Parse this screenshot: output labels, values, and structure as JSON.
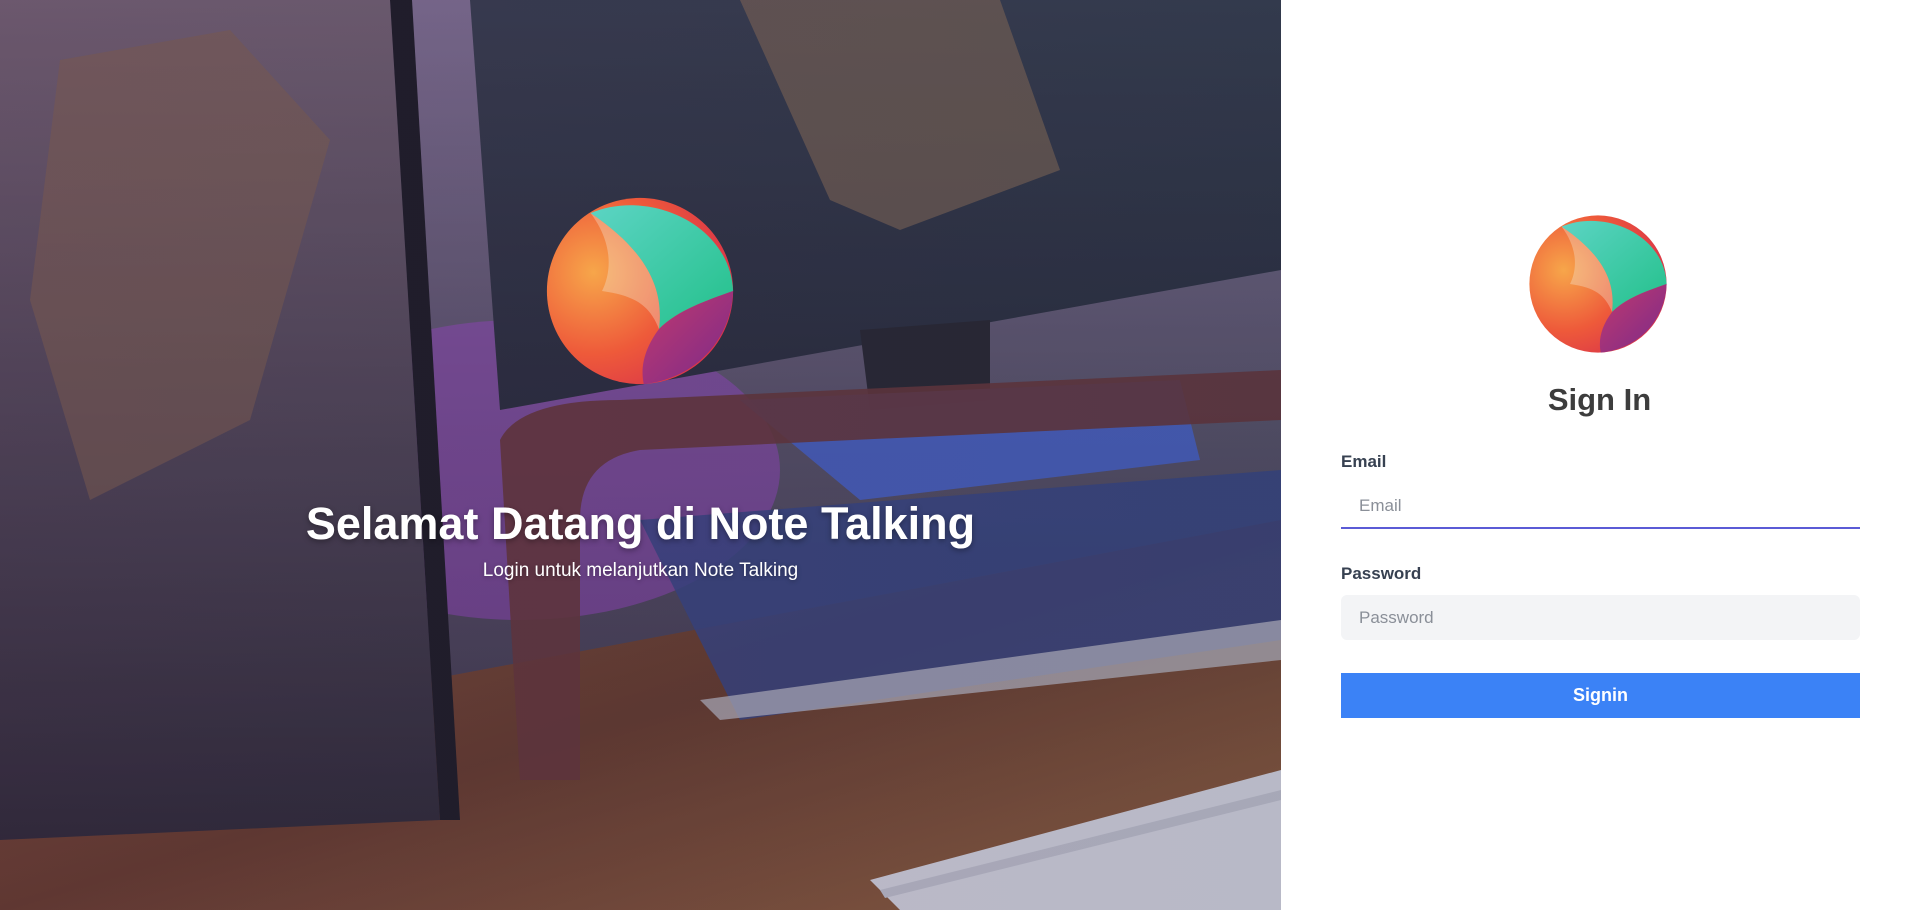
{
  "hero": {
    "title": "Selamat Datang di Note Talking",
    "subtitle": "Login untuk melanjutkan Note Talking"
  },
  "form": {
    "title": "Sign In",
    "email_label": "Email",
    "email_placeholder": "Email",
    "email_value": "",
    "password_label": "Password",
    "password_placeholder": "Password",
    "password_value": "",
    "submit_label": "Signin"
  },
  "colors": {
    "accent": "#3b82f6",
    "focus_underline": "#5b5bd6",
    "title_text": "#3d3d3d",
    "label_text": "#374151",
    "input_bg": "#f3f4f6"
  },
  "icons": {
    "logo": "note-talking-logo-icon"
  }
}
